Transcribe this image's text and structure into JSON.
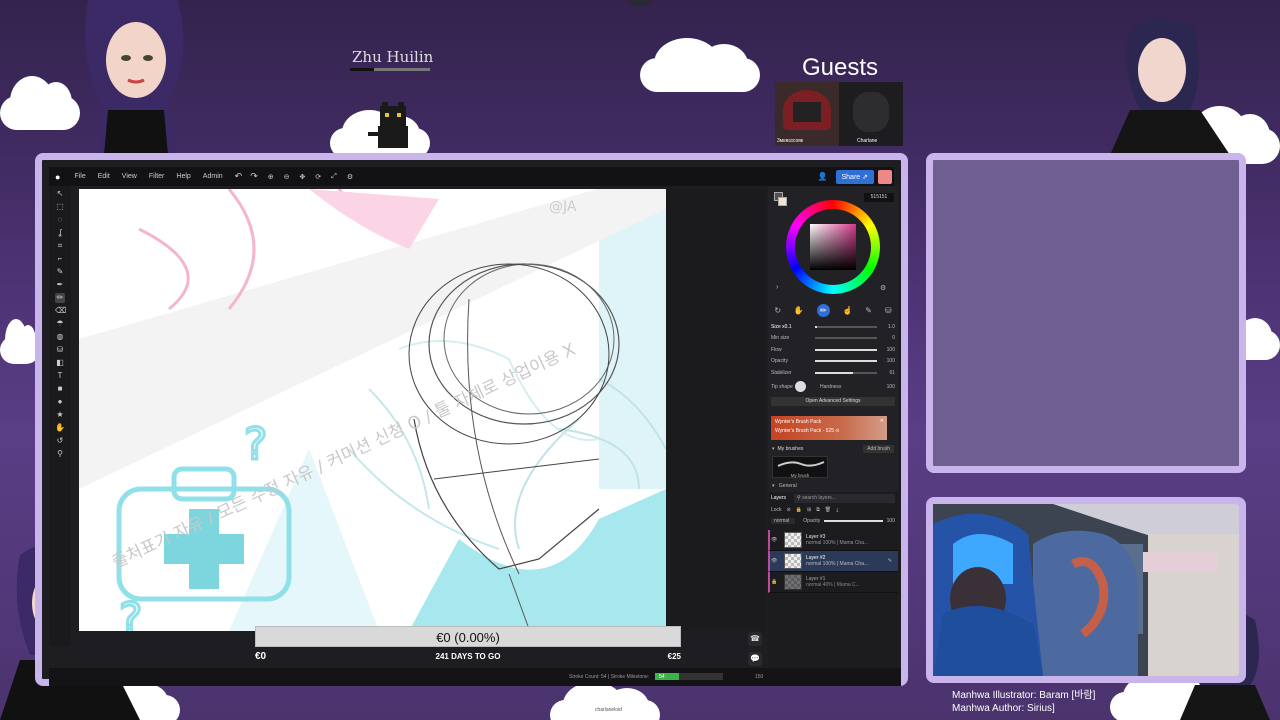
{
  "stream": {
    "streamer_name": "Zhu Huilin",
    "guests_label": "Guests",
    "guests": [
      "3ᴍᴇʀɢɪᴄᴏʀᴇ",
      "Charlane"
    ],
    "credits": {
      "illustrator": "Manhwa  Illustrator: Baram [바람]",
      "author": "Manhwa  Author: Sirius]"
    },
    "bottom_tag": "charlaneloid"
  },
  "app": {
    "menu": [
      "File",
      "Edit",
      "View",
      "Filter",
      "Help",
      "Admin"
    ],
    "share_label": "Share",
    "hex_value": "515151",
    "brush": {
      "size_label": "Size x0.1",
      "size_value": "1.0",
      "min_size_label": "Min size",
      "min_size_value": "0",
      "flow_label": "Flow",
      "flow_value": "100",
      "opacity_label": "Opacity",
      "opacity_value": "100",
      "stabilizer_label": "Stabilizer",
      "stabilizer_value": "61",
      "tip_shape_label": "Tip shape",
      "hardness_label": "Hardness",
      "hardness_value": "100",
      "advanced_label": "Open Advanced Settings"
    },
    "brush_pack": {
      "title": "Wynter's Brush Pack",
      "subtitle": "Wynter's Brush Pack · 525 ⊙"
    },
    "my_brushes_label": "My brushes",
    "add_brush_label": "Add brush",
    "my_brush_name": "My brush",
    "general_label": "General",
    "layers": {
      "tab_label": "Layers",
      "search_placeholder": "search layers...",
      "lock_label": "Lock",
      "blend_mode": "normal",
      "opacity_label": "Opacity",
      "opacity_value": "100",
      "items": [
        {
          "name": "Layer #3",
          "info": "normal  100% | Mama Cha..."
        },
        {
          "name": "Layer #2",
          "info": "normal  100% | Mama Cha..."
        },
        {
          "name": "Layer #1",
          "info": "normal  40% | Mama C..."
        }
      ]
    },
    "status": {
      "stroke_count": "Stroke Count: 54  |  Stroke Milestone:",
      "milestone_value": "54",
      "milestone_target": "150"
    }
  },
  "donation": {
    "current": "€0 (0.00%)",
    "start": "€0",
    "end": "€25",
    "days_left": "241 DAYS TO GO",
    "progress_fraction": 0.0
  },
  "canvas": {
    "watermark": "출처표기 자유 / 모든 수정 자유 / 커미션 신청 O / 툴 자체로 상업이용 X",
    "handle": "@JA"
  },
  "colors": {
    "accent": "#2f6fd6",
    "frame": "#c9b4ec",
    "background": "#4a3170",
    "canvas_cyan": "#8fe0e8"
  }
}
